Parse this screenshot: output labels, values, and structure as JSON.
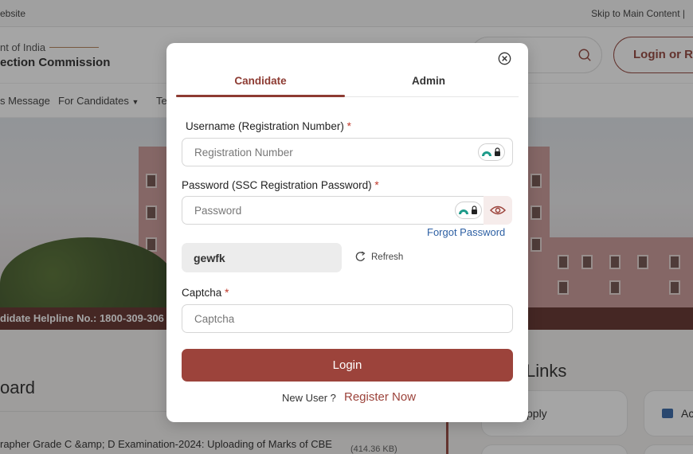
{
  "background": {
    "topbar": {
      "left_text": "ebsite",
      "right_text": "Skip to Main Content |"
    },
    "header": {
      "govt_text": "nt of India",
      "commission_text": "ection Commission",
      "login_register_label": "Login or Re"
    },
    "nav": {
      "items": [
        "s Message",
        "For Candidates",
        "Te"
      ]
    },
    "helpline": "didate Helpline No.: 1800-309-306",
    "board_title": "oard",
    "notice": {
      "text": "rapher Grade C &amp; D Examination-2024: Uploading of Marks of CBE",
      "size": "(414.36 KB)"
    },
    "quick_links": {
      "title": "Links",
      "items": [
        "pply",
        "Ac"
      ]
    }
  },
  "modal": {
    "tabs": [
      {
        "label": "Candidate",
        "active": true
      },
      {
        "label": "Admin",
        "active": false
      }
    ],
    "username": {
      "label": "Username (Registration Number)",
      "required_mark": "*",
      "placeholder": "Registration Number"
    },
    "password": {
      "label": "Password (SSC Registration Password)",
      "required_mark": "*",
      "placeholder": "Password"
    },
    "forgot_password": "Forgot Password",
    "captcha_image_text": "gewfk",
    "refresh_label": "Refresh",
    "captcha": {
      "label": "Captcha",
      "required_mark": "*",
      "placeholder": "Captcha"
    },
    "login_button": "Login",
    "new_user_text": "New User ?",
    "register_link": "Register Now"
  },
  "colors": {
    "accent": "#8d3b32",
    "button": "#9c433b",
    "link": "#2c5fa3",
    "required": "#c0392b"
  },
  "icons": [
    "search-icon",
    "close-icon",
    "password-manager-icon",
    "eye-icon",
    "refresh-icon",
    "chevron-down-icon"
  ]
}
